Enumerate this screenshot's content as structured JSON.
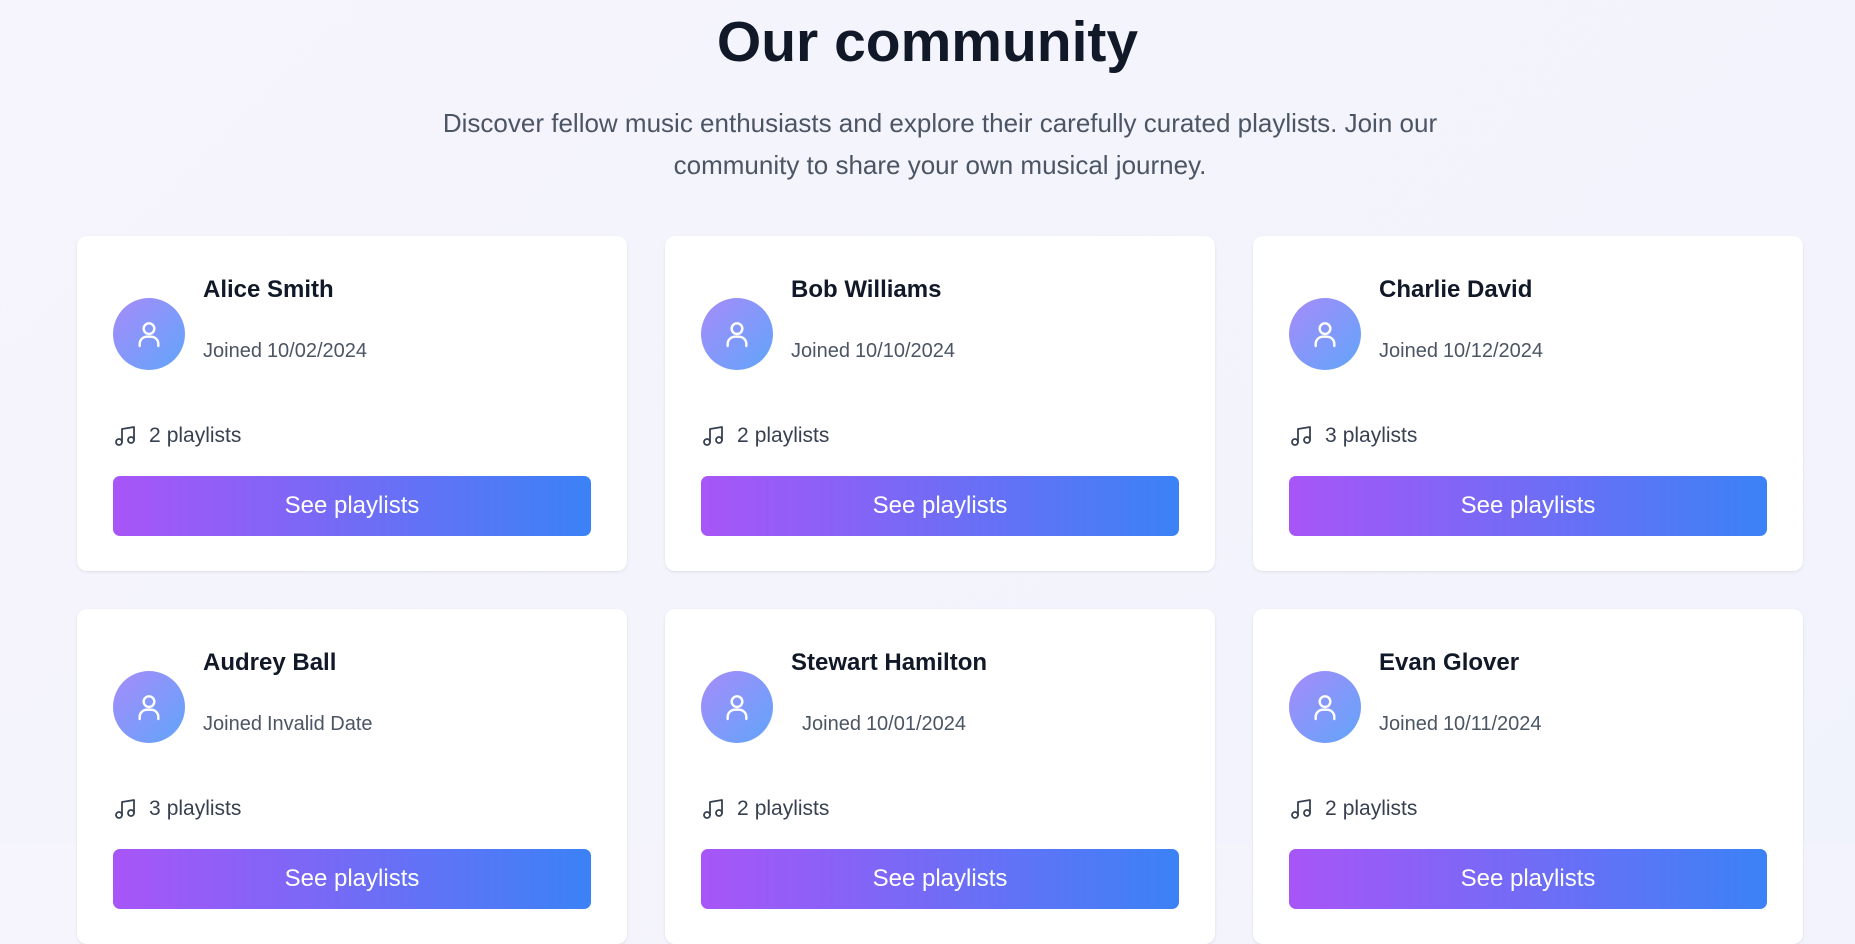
{
  "header": {
    "title": "Our community",
    "subtitle": "Discover fellow music enthusiasts and explore their carefully curated playlists. Join our community to share your own musical journey."
  },
  "labels": {
    "joined_prefix": "Joined",
    "playlists_suffix": "playlists",
    "see_playlists": "See playlists"
  },
  "colors": {
    "avatar_gradient": [
      "#a78bfa",
      "#60a5fa"
    ],
    "button_gradient": [
      "#a855f7",
      "#3b82f6"
    ]
  },
  "icons": {
    "avatar": "user-icon",
    "playlists": "music-note-icon"
  },
  "members": [
    {
      "name": "Alice Smith",
      "joined": "10/02/2024",
      "playlists": 2
    },
    {
      "name": "Bob Williams",
      "joined": "10/10/2024",
      "playlists": 2
    },
    {
      "name": "Charlie David",
      "joined": "10/12/2024",
      "playlists": 3
    },
    {
      "name": "Audrey Ball",
      "joined": "Invalid Date",
      "playlists": 3
    },
    {
      "name": "Stewart Hamilton",
      "joined": "10/01/2024",
      "playlists": 2
    },
    {
      "name": "Evan Glover",
      "joined": "10/11/2024",
      "playlists": 2
    }
  ]
}
